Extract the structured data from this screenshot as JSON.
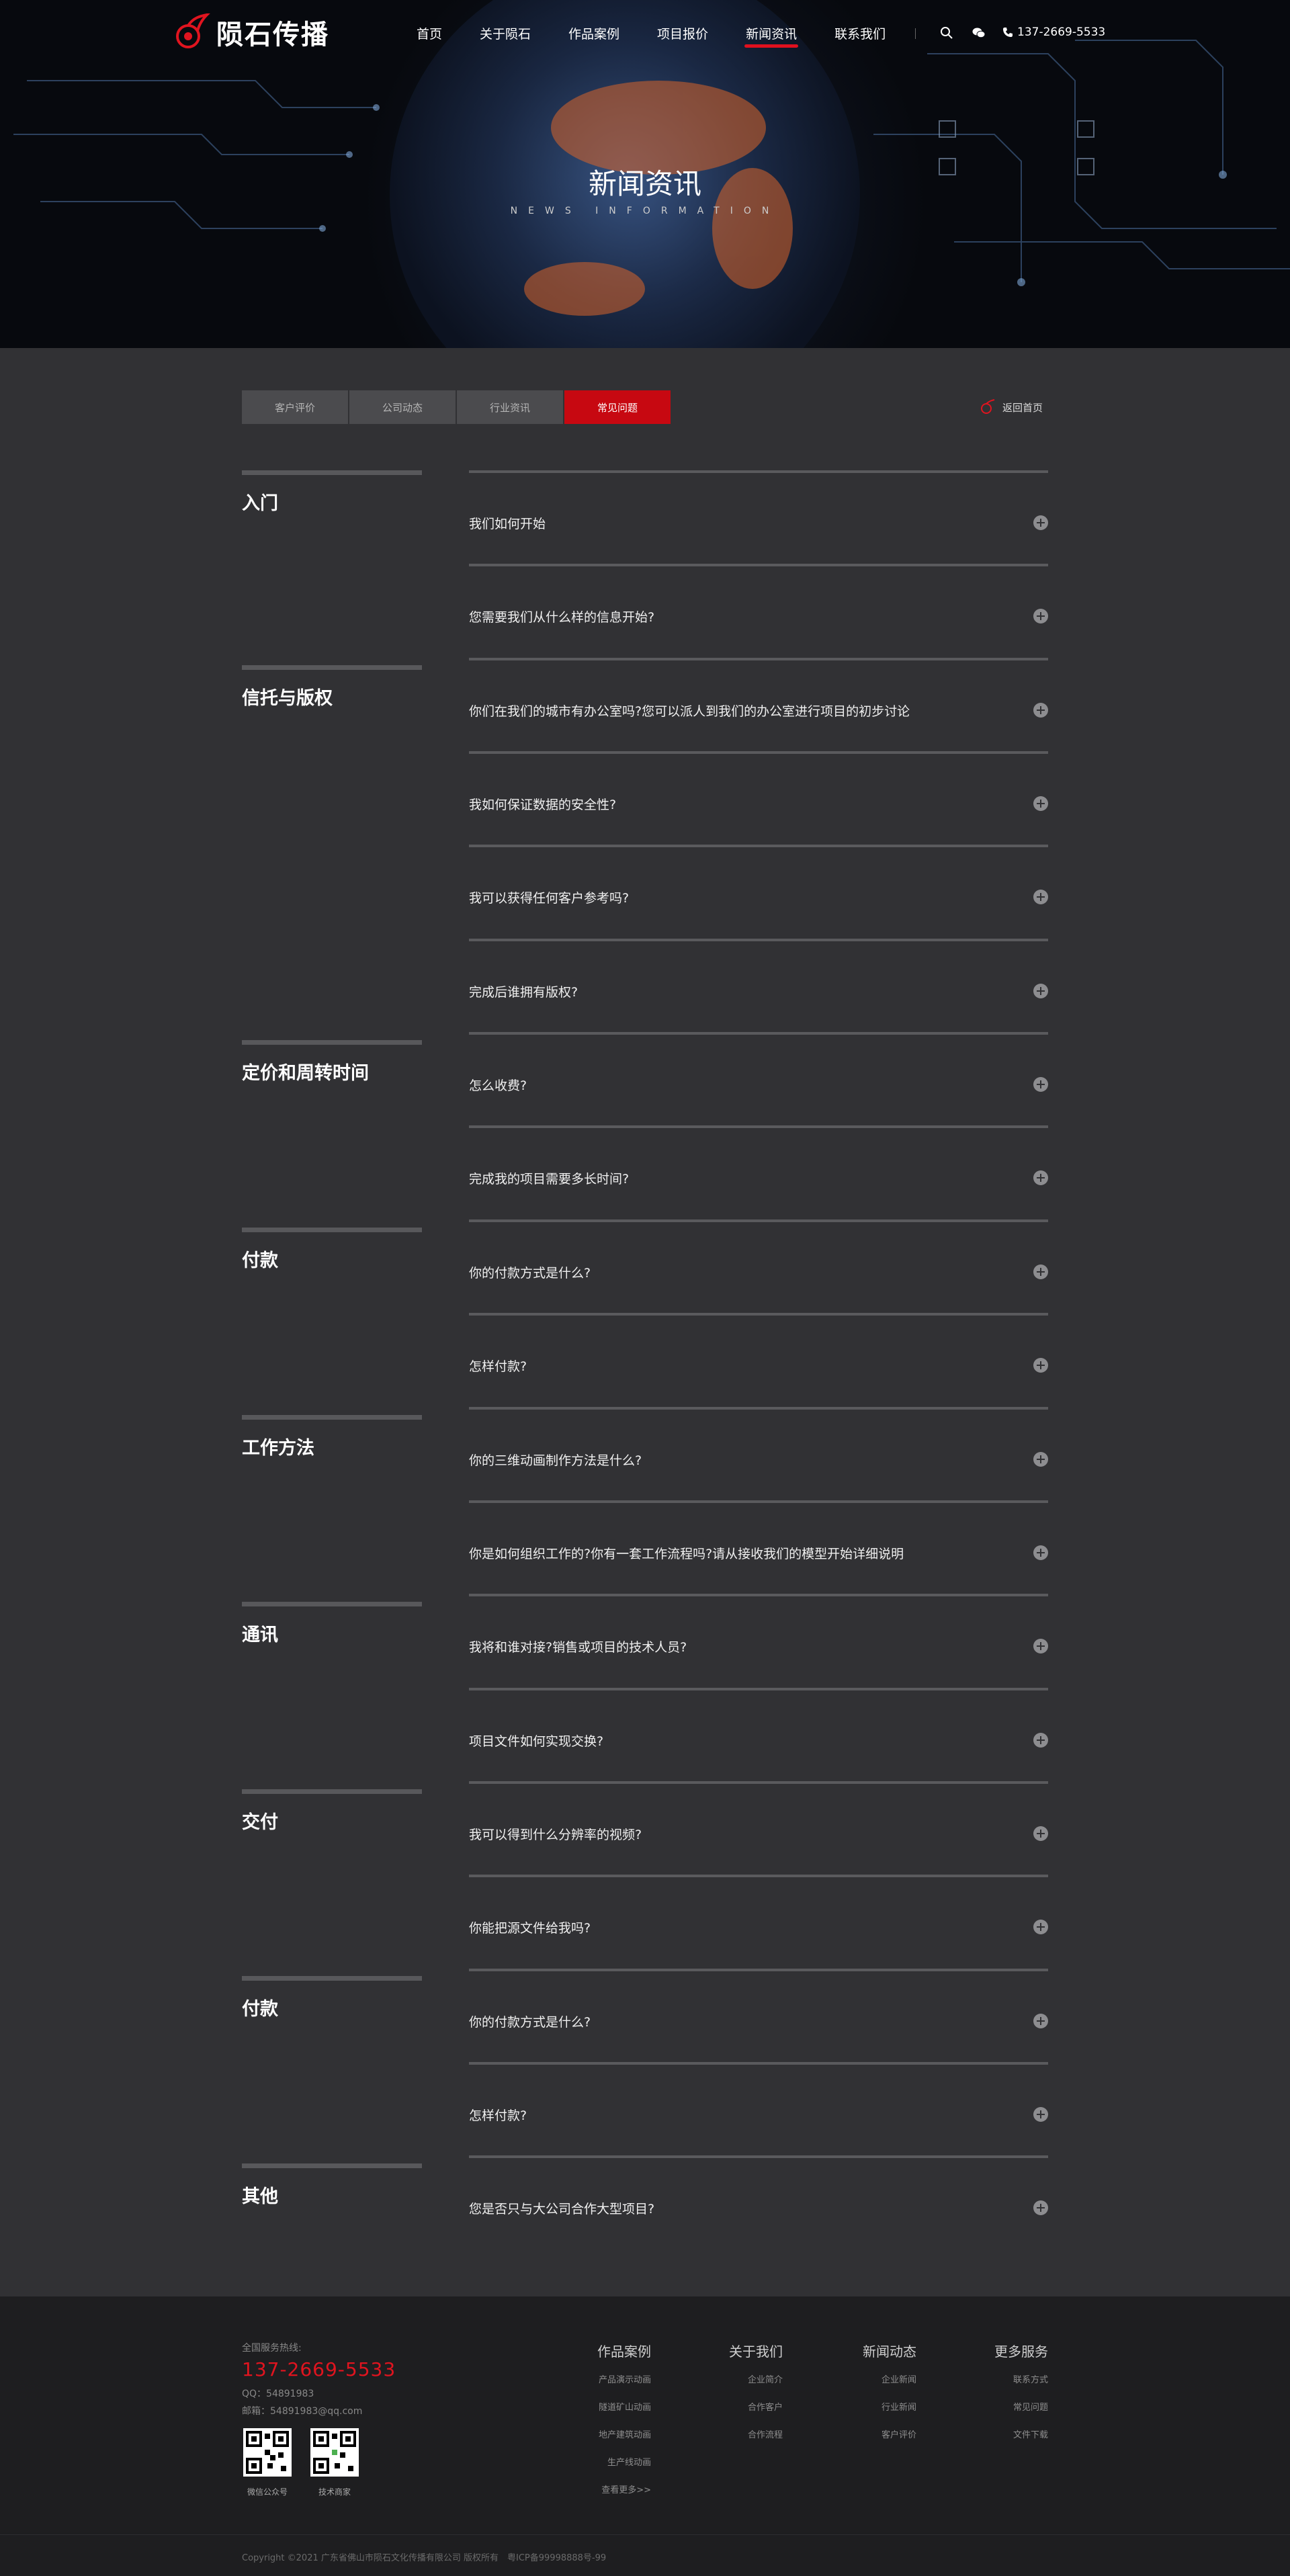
{
  "header": {
    "logo_text": "陨石传播",
    "nav": [
      "首页",
      "关于陨石",
      "作品案例",
      "项目报价",
      "新闻资讯",
      "联系我们"
    ],
    "active_nav": "新闻资讯",
    "phone": "137-2669-5533"
  },
  "hero": {
    "title": "新闻资讯",
    "subtitle": "NEWS INFORMATION"
  },
  "tabs": {
    "items": [
      "客户评价",
      "公司动态",
      "行业资讯",
      "常见问题"
    ],
    "active": "常见问题"
  },
  "back_home": "返回首页",
  "categories": [
    "入门",
    "信托与版权",
    "定价和周转时间",
    "付款",
    "工作方法",
    "通讯",
    "交付",
    "付款",
    "其他"
  ],
  "questions": [
    "我们如何开始",
    "您需要我们从什么样的信息开始?",
    "你们在我们的城市有办公室吗?您可以派人到我们的办公室进行项目的初步讨论",
    "我如何保证数据的安全性?",
    "我可以获得任何客户参考吗?",
    "完成后谁拥有版权?",
    "怎么收费?",
    "完成我的项目需要多长时间?",
    "你的付款方式是什么?",
    "怎样付款?",
    "你的三维动画制作方法是什么?",
    "你是如何组织工作的?你有一套工作流程吗?请从接收我们的模型开始详细说明",
    "我将和谁对接?销售或项目的技术人员?",
    "项目文件如何实现交换?",
    "我可以得到什么分辨率的视频?",
    "你能把源文件给我吗?",
    "你的付款方式是什么?",
    "怎样付款?",
    "您是否只与大公司合作大型项目?"
  ],
  "footer": {
    "hotline_label": "全国服务热线:",
    "hotline": "137-2669-5533",
    "qq": "QQ：54891983",
    "mail": "邮箱：54891983@qq.com",
    "qr_captions": [
      "微信公众号",
      "技术商家"
    ],
    "columns": [
      {
        "title": "作品案例",
        "links": [
          "产品演示动画",
          "隧道矿山动画",
          "地产建筑动画",
          "生产线动画",
          "查看更多>>"
        ]
      },
      {
        "title": "关于我们",
        "links": [
          "企业简介",
          "合作客户",
          "合作流程"
        ]
      },
      {
        "title": "新闻动态",
        "links": [
          "企业新闻",
          "行业新闻",
          "客户评价"
        ]
      },
      {
        "title": "更多服务",
        "links": [
          "联系方式",
          "常见问题",
          "文件下载"
        ]
      }
    ],
    "copyright": "Copyright ©2021 广东省佛山市陨石文化传播有限公司 版权所有　粤ICP备99998888号-99"
  },
  "colors": {
    "accent_red": "#c70811",
    "page_bg": "#313134",
    "footer_bg": "#1e1e20"
  }
}
